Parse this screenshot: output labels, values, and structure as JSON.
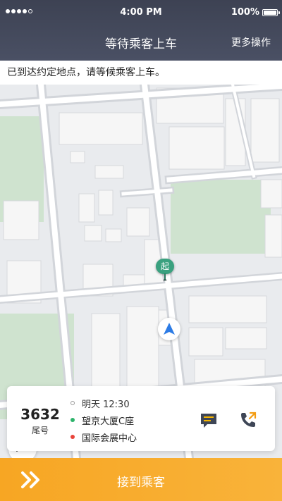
{
  "status_bar": {
    "time": "4:00 PM",
    "battery": "100%"
  },
  "header": {
    "title": "等待乘客上车",
    "more_ops": "更多操作"
  },
  "notice": "已到达约定地点，请等候乘客上车。",
  "map": {
    "start_marker": "起",
    "icons": [
      "start-pin-icon",
      "navigation-arrow-icon",
      "traffic-light-icon",
      "locate-icon"
    ]
  },
  "order": {
    "tail_number": "3632",
    "tail_label": "尾号",
    "time": "明天 12:30",
    "pickup": "望京大厦C座",
    "dropoff": "国际会展中心",
    "colors": {
      "pickup": "#2db36b",
      "dropoff": "#e8443a",
      "icon": "#3e4656",
      "call_accent": "#f39c12"
    }
  },
  "action": {
    "label": "接到乘客",
    "color": "#f7a623"
  }
}
